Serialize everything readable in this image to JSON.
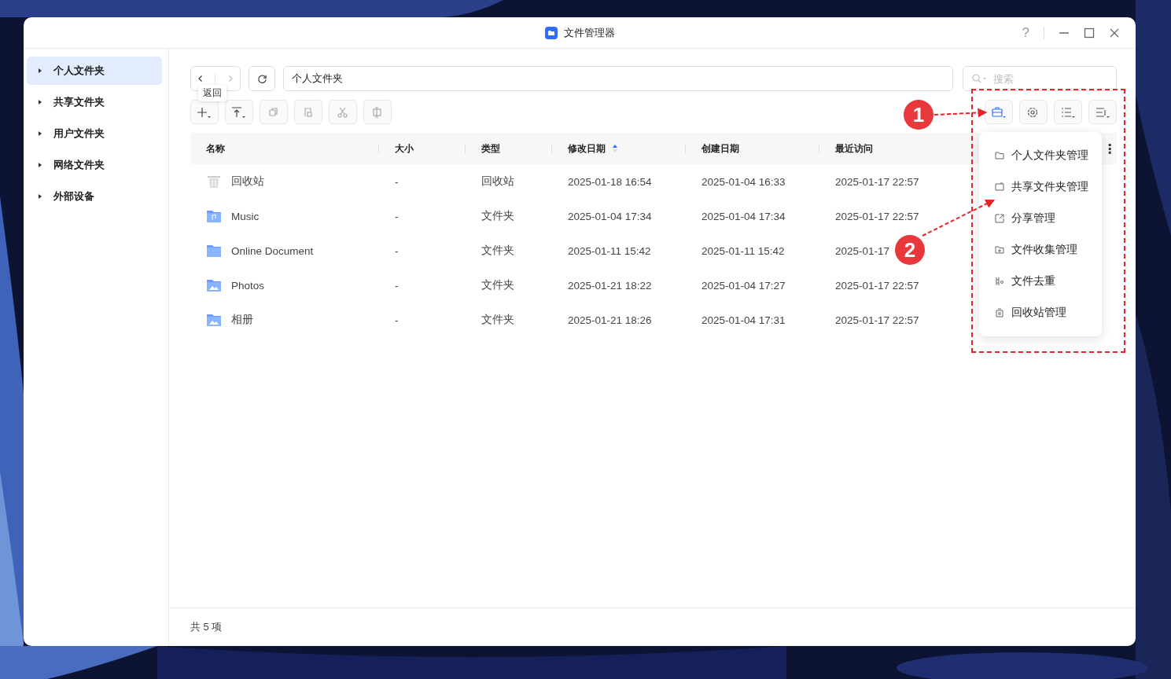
{
  "window": {
    "title": "文件管理器",
    "help": "?"
  },
  "sidebar": {
    "items": [
      {
        "label": "个人文件夹",
        "selected": true
      },
      {
        "label": "共享文件夹",
        "selected": false
      },
      {
        "label": "用户文件夹",
        "selected": false
      },
      {
        "label": "网络文件夹",
        "selected": false
      },
      {
        "label": "外部设备",
        "selected": false
      }
    ]
  },
  "path": {
    "value": "个人文件夹"
  },
  "search": {
    "placeholder": "搜索"
  },
  "tooltip": "返回",
  "toolbar_left": [
    {
      "kind": "add",
      "disabled": false
    },
    {
      "kind": "upload",
      "disabled": false
    },
    {
      "kind": "copy",
      "disabled": true
    },
    {
      "kind": "paste",
      "disabled": true
    },
    {
      "kind": "cut",
      "disabled": true
    },
    {
      "kind": "move",
      "disabled": true
    }
  ],
  "toolbar_right": [
    {
      "kind": "tools",
      "selected": true
    },
    {
      "kind": "settings",
      "selected": false
    },
    {
      "kind": "view",
      "selected": false
    },
    {
      "kind": "sort",
      "selected": false
    }
  ],
  "table": {
    "columns": [
      {
        "label": "名称",
        "sorted": false
      },
      {
        "label": "大小",
        "sorted": false
      },
      {
        "label": "类型",
        "sorted": false
      },
      {
        "label": "修改日期",
        "sorted": true
      },
      {
        "label": "创建日期",
        "sorted": false
      },
      {
        "label": "最近访问",
        "sorted": false
      }
    ],
    "more": "⋮",
    "rows": [
      {
        "kind": "trash",
        "name": "回收站",
        "size": "-",
        "type": "回收站",
        "modified": "2025-01-18 16:54",
        "created": "2025-01-04 16:33",
        "accessed": "2025-01-17 22:57"
      },
      {
        "kind": "music",
        "name": "Music",
        "size": "-",
        "type": "文件夹",
        "modified": "2025-01-04 17:34",
        "created": "2025-01-04 17:34",
        "accessed": "2025-01-17 22:57"
      },
      {
        "kind": "folder",
        "name": "Online Document",
        "size": "-",
        "type": "文件夹",
        "modified": "2025-01-11 15:42",
        "created": "2025-01-11 15:42",
        "accessed": "2025-01-17"
      },
      {
        "name": "Photos",
        "size": "-",
        "type": "文件夹",
        "modified": "2025-01-21 18:22",
        "created": "2025-01-04 17:27",
        "accessed": "2025-01-17 22:57"
      },
      {
        "name": "相册",
        "size": "-",
        "type": "文件夹",
        "modified": "2025-01-21 18:26",
        "created": "2025-01-04 17:31",
        "accessed": "2025-01-17 22:57"
      }
    ]
  },
  "menu": [
    {
      "kind": "folder",
      "label": "个人文件夹管理"
    },
    {
      "kind": "shared",
      "label": "共享文件夹管理"
    },
    {
      "kind": "share",
      "label": "分享管理"
    },
    {
      "kind": "collect",
      "label": "文件收集管理"
    },
    {
      "kind": "dedupe",
      "label": "文件去重"
    },
    {
      "kind": "trash",
      "label": "回收站管理"
    }
  ],
  "annotations": [
    {
      "label": "1"
    },
    {
      "label": "2"
    }
  ],
  "status_bar": "共 5 项"
}
